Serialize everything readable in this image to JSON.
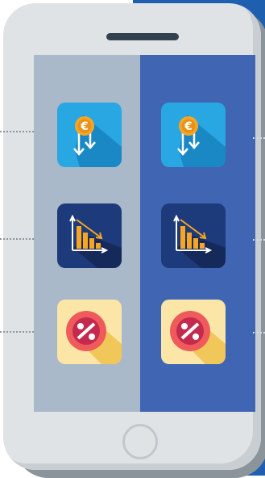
{
  "colors": {
    "bg_right": "#1f5fb0",
    "phone_body": "#dfe3e6",
    "screen_left": "#a9b9c9",
    "screen_right": "#3f65b3",
    "coin": "#f6a623",
    "euro_symbol": "€",
    "percent_symbol": "%"
  },
  "icons": {
    "left": [
      "euro-coin-down-arrows-icon",
      "declining-bar-chart-icon",
      "percent-badge-icon"
    ],
    "right": [
      "euro-coin-down-arrows-icon",
      "declining-bar-chart-icon",
      "percent-badge-icon"
    ]
  }
}
